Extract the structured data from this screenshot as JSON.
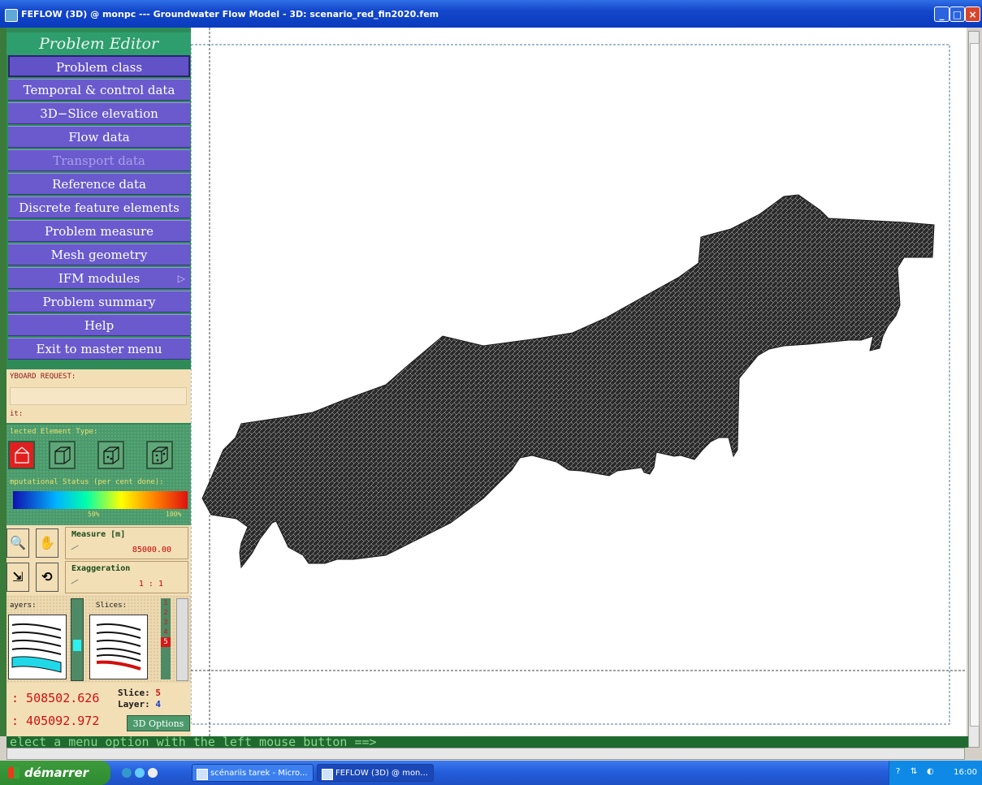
{
  "window": {
    "title": "FEFLOW (3D) @ monpc --- Groundwater Flow Model - 3D: scenario_red_fin2020.fem"
  },
  "editor": {
    "title": "Problem Editor",
    "menu": [
      "Problem class",
      "Temporal & control data",
      "3D−Slice elevation",
      "Flow data",
      "Transport data",
      "Reference data",
      "Discrete feature elements",
      "Problem measure",
      "Mesh geometry",
      "IFM modules",
      "Problem summary",
      "Help",
      "Exit to master menu"
    ]
  },
  "keyboard": {
    "label": "YBOARD REQUEST:",
    "unit_label": "it:"
  },
  "elements": {
    "label": "lected Element Type:",
    "status_label": "mputational Status (per cent done):",
    "scale_50": "50%",
    "scale_100": "100%"
  },
  "measure": {
    "label": "Measure [m]",
    "value": "85000.00"
  },
  "exaggeration": {
    "label": "Exaggeration",
    "value": "1 : 1"
  },
  "layers": {
    "layers_label": "ayers:",
    "slices_label": "Slices:",
    "slice_numbers": [
      "1",
      "2",
      "3",
      "4",
      "5"
    ],
    "selected_slice": "5"
  },
  "coords": {
    "x": ": 508502.626",
    "y": ": 405092.972",
    "slice_label": "Slice:",
    "slice_value": "5",
    "layer_label": "Layer:",
    "layer_value": "4",
    "options_button": "3D Options"
  },
  "status": {
    "message": "elect a menu option with the left mouse button ==>"
  },
  "taskbar": {
    "start": "démarrer",
    "tasks": [
      "scénariis tarek - Micro...",
      "FEFLOW (3D) @ mon..."
    ],
    "clock": "16:00"
  },
  "colors": {
    "menu": "#6a5acd",
    "panel_green": "#2e8b57",
    "tan": "#f3dfb6",
    "mesh": "#2b2b2b"
  }
}
